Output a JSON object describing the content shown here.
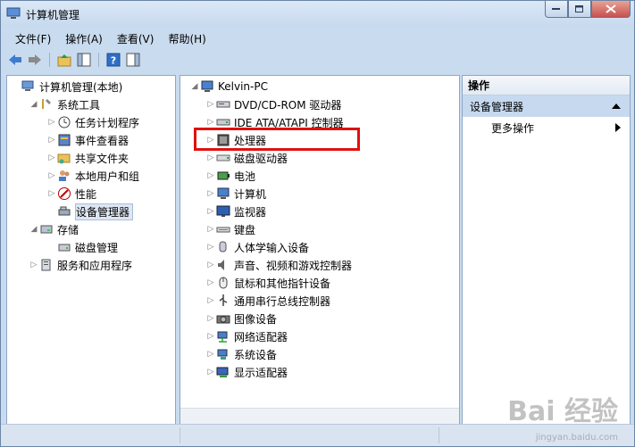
{
  "window": {
    "title": "计算机管理"
  },
  "menubar": [
    "文件(F)",
    "操作(A)",
    "查看(V)",
    "帮助(H)"
  ],
  "left_tree": [
    {
      "label": "计算机管理(本地)",
      "icon": "computer-management-icon",
      "indent": 0,
      "expander": "",
      "selected": false
    },
    {
      "label": "系统工具",
      "icon": "tools-icon",
      "indent": 1,
      "expander": "◢",
      "selected": false
    },
    {
      "label": "任务计划程序",
      "icon": "clock-icon",
      "indent": 2,
      "expander": "▷",
      "selected": false
    },
    {
      "label": "事件查看器",
      "icon": "event-viewer-icon",
      "indent": 2,
      "expander": "▷",
      "selected": false
    },
    {
      "label": "共享文件夹",
      "icon": "shared-folder-icon",
      "indent": 2,
      "expander": "▷",
      "selected": false
    },
    {
      "label": "本地用户和组",
      "icon": "users-icon",
      "indent": 2,
      "expander": "▷",
      "selected": false
    },
    {
      "label": "性能",
      "icon": "performance-icon",
      "indent": 2,
      "expander": "▷",
      "selected": false
    },
    {
      "label": "设备管理器",
      "icon": "device-manager-icon",
      "indent": 2,
      "expander": "",
      "selected": true
    },
    {
      "label": "存储",
      "icon": "storage-icon",
      "indent": 1,
      "expander": "◢",
      "selected": false
    },
    {
      "label": "磁盘管理",
      "icon": "disk-icon",
      "indent": 2,
      "expander": "",
      "selected": false
    },
    {
      "label": "服务和应用程序",
      "icon": "services-icon",
      "indent": 1,
      "expander": "▷",
      "selected": false
    }
  ],
  "device_tree": {
    "root": "Kelvin-PC",
    "items": [
      {
        "label": "DVD/CD-ROM 驱动器",
        "icon": "dvd-drive-icon"
      },
      {
        "label": "IDE ATA/ATAPI 控制器",
        "icon": "ide-controller-icon"
      },
      {
        "label": "处理器",
        "icon": "processor-icon"
      },
      {
        "label": "磁盘驱动器",
        "icon": "disk-drive-icon"
      },
      {
        "label": "电池",
        "icon": "battery-icon"
      },
      {
        "label": "计算机",
        "icon": "computer-icon"
      },
      {
        "label": "监视器",
        "icon": "monitor-icon"
      },
      {
        "label": "键盘",
        "icon": "keyboard-icon"
      },
      {
        "label": "人体学输入设备",
        "icon": "hid-icon"
      },
      {
        "label": "声音、视频和游戏控制器",
        "icon": "sound-icon"
      },
      {
        "label": "鼠标和其他指针设备",
        "icon": "mouse-icon"
      },
      {
        "label": "通用串行总线控制器",
        "icon": "usb-icon"
      },
      {
        "label": "图像设备",
        "icon": "camera-icon"
      },
      {
        "label": "网络适配器",
        "icon": "network-icon"
      },
      {
        "label": "系统设备",
        "icon": "system-device-icon"
      },
      {
        "label": "显示适配器",
        "icon": "display-adapter-icon"
      }
    ]
  },
  "actions": {
    "header": "操作",
    "section": "设备管理器",
    "more": "更多操作"
  },
  "watermark": {
    "text": "Bai 经验",
    "sub": "jingyan.baidu.com"
  }
}
